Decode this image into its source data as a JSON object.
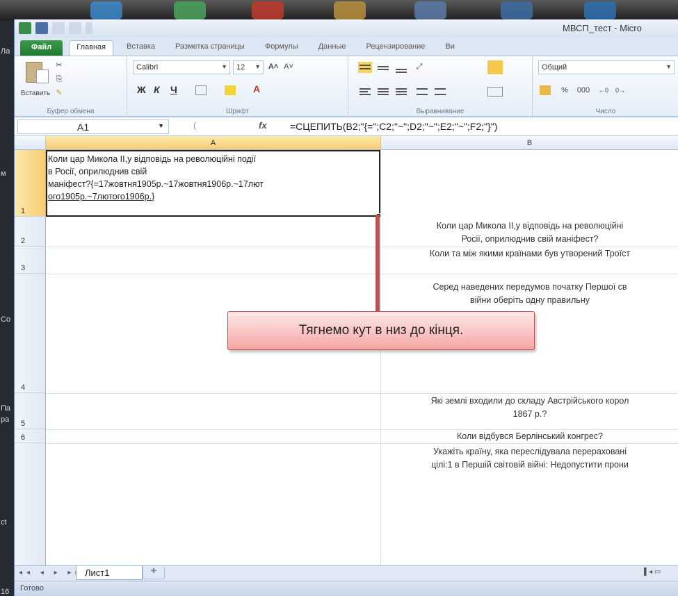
{
  "window": {
    "title": "МВСП_тест - Micro"
  },
  "desktop": {
    "left_labels": [
      "Ла",
      "м",
      "Со",
      "Па",
      "ра",
      "ct",
      "16"
    ]
  },
  "tabs": [
    "Файл",
    "Главная",
    "Вставка",
    "Разметка страницы",
    "Формулы",
    "Данные",
    "Рецензирование",
    "Ви"
  ],
  "ribbon": {
    "clipboard": {
      "paste_label": "Вставить",
      "group_label": "Буфер обмена"
    },
    "font": {
      "font_name": "Calibri",
      "font_size": "12",
      "group_label": "Шрифт",
      "bold": "Ж",
      "italic": "К",
      "underline": "Ч"
    },
    "alignment": {
      "group_label": "Выравнивание"
    },
    "number": {
      "format": "Общий",
      "percent": "%",
      "thousands": "000",
      "group_label": "Число"
    }
  },
  "formula_bar": {
    "name_box": "A1",
    "fx_label": "fx",
    "formula": "=СЦЕПИТЬ(B2;\"{=\";C2;\"~\";D2;\"~\";E2;\"~\";F2;\"}\")"
  },
  "sheet": {
    "columns": [
      "A",
      "B"
    ],
    "rows": [
      "1",
      "2",
      "3",
      "4",
      "5",
      "6"
    ],
    "cell_a1": {
      "line1": "Коли цар Микола ІІ,у відповідь на революційні події",
      "line2": "в Росії, оприлюднив свій",
      "line3": "маніфест?{=17жовтня1905р.~17жовтня1906р.~17лют",
      "line4": "ого1905р.~7лютого1906р.}"
    },
    "column_b": {
      "b2_line1": "Коли цар Микола ІІ,у відповідь на революційні",
      "b2_line2": "Росії, оприлюднив свій маніфест?",
      "b3": "Коли та між якими країнами був утворений Троїст",
      "b4_line1": "Серед наведених передумов початку Першої св",
      "b4_line2": "війни оберіть одну правильну",
      "b5_line1": "Які землі входили до складу Австрійського корол",
      "b5_line2": "1867 р.?",
      "b6": "Коли відбувся Берлінський конгрес?",
      "b7_line1": "Укажіть країну, яка переслідувала перераховані",
      "b7_line2": "цілі:1 в Першій світовій війні: Недопустити прони"
    }
  },
  "callout": {
    "text": "Тягнемо кут в низ до кінця."
  },
  "sheet_tabs": {
    "active": "Лист1"
  },
  "status": {
    "text": "Готово"
  }
}
